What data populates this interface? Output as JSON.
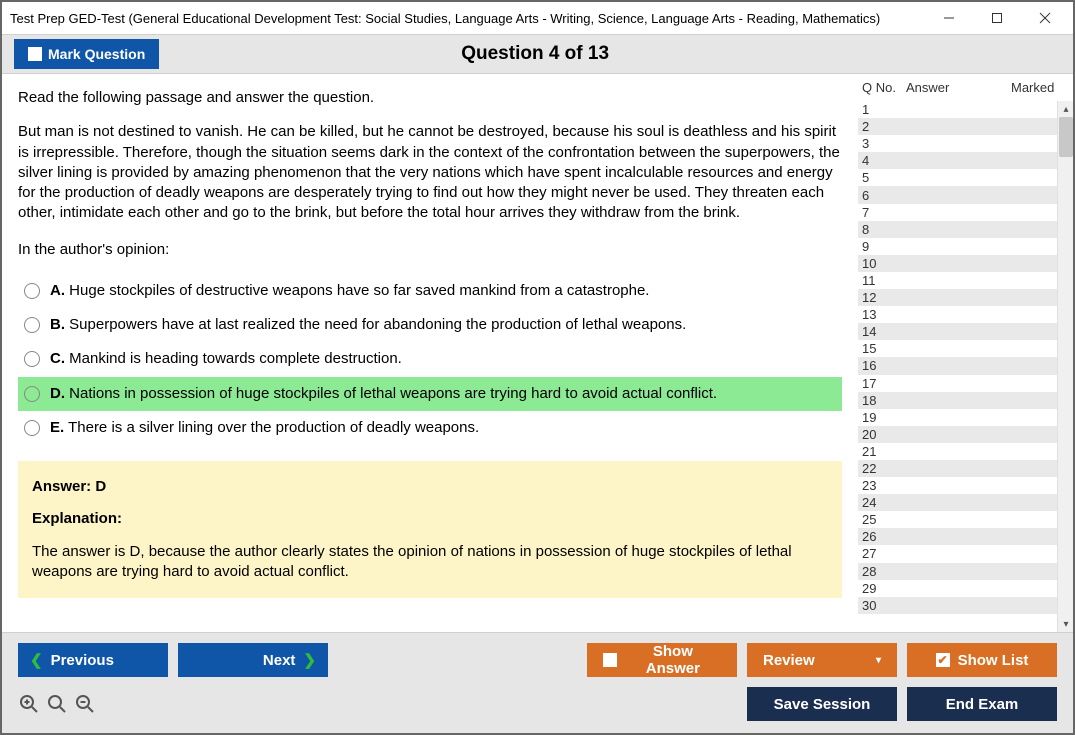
{
  "window": {
    "title": "Test Prep GED-Test (General Educational Development Test: Social Studies, Language Arts - Writing, Science, Language Arts - Reading, Mathematics)"
  },
  "topbar": {
    "mark_label": "Mark Question",
    "header": "Question 4 of 13"
  },
  "question": {
    "instruction": "Read the following passage and answer the question.",
    "passage": "But man is not destined to vanish. He can be killed, but he cannot be destroyed, because his soul is deathless and his spirit is irrepressible. Therefore, though the situation seems dark in the context of the confrontation between the superpowers, the silver lining is provided by amazing phenomenon that the very nations which have spent incalculable resources and energy for the production of deadly weapons are desperately trying to find out how they might never be used. They threaten each other, intimidate each other and go to the brink, but before the total hour arrives they withdraw from the brink.",
    "prompt": "In the author's opinion:",
    "options": [
      {
        "letter": "A.",
        "text": "Huge stockpiles of destructive weapons have so far saved mankind from a catastrophe."
      },
      {
        "letter": "B.",
        "text": "Superpowers have at last realized the need for abandoning the production of lethal weapons."
      },
      {
        "letter": "C.",
        "text": "Mankind is heading towards complete destruction."
      },
      {
        "letter": "D.",
        "text": "Nations in possession of huge stockpiles of lethal weapons are trying hard to avoid actual conflict."
      },
      {
        "letter": "E.",
        "text": "There is a silver lining over the production of deadly weapons."
      }
    ],
    "selected_index": 3,
    "answer": {
      "line": "Answer: D",
      "explanation_label": "Explanation:",
      "explanation_text": "The answer is D, because the author clearly states the opinion of nations in possession of huge stockpiles of lethal weapons are trying hard to avoid actual conflict."
    }
  },
  "sidepanel": {
    "headers": {
      "q": "Q No.",
      "a": "Answer",
      "m": "Marked"
    },
    "rows": [
      {
        "n": "1"
      },
      {
        "n": "2"
      },
      {
        "n": "3"
      },
      {
        "n": "4"
      },
      {
        "n": "5"
      },
      {
        "n": "6"
      },
      {
        "n": "7"
      },
      {
        "n": "8"
      },
      {
        "n": "9"
      },
      {
        "n": "10"
      },
      {
        "n": "11"
      },
      {
        "n": "12"
      },
      {
        "n": "13"
      },
      {
        "n": "14"
      },
      {
        "n": "15"
      },
      {
        "n": "16"
      },
      {
        "n": "17"
      },
      {
        "n": "18"
      },
      {
        "n": "19"
      },
      {
        "n": "20"
      },
      {
        "n": "21"
      },
      {
        "n": "22"
      },
      {
        "n": "23"
      },
      {
        "n": "24"
      },
      {
        "n": "25"
      },
      {
        "n": "26"
      },
      {
        "n": "27"
      },
      {
        "n": "28"
      },
      {
        "n": "29"
      },
      {
        "n": "30"
      }
    ]
  },
  "footer": {
    "previous": "Previous",
    "next": "Next",
    "show_answer": "Show Answer",
    "review": "Review",
    "show_list": "Show List",
    "save_session": "Save Session",
    "end_exam": "End Exam"
  }
}
